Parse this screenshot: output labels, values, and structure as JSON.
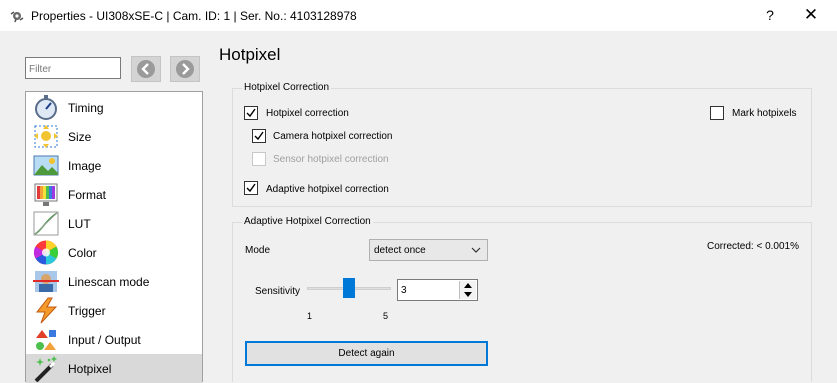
{
  "window": {
    "title": "Properties - UI308xSE-C | Cam. ID: 1 | Ser. No.: 4103128978",
    "help_label": "?",
    "close_label": "✕"
  },
  "sidebar": {
    "filter_placeholder": "Filter",
    "items": [
      {
        "label": "Timing",
        "icon": "stopwatch-icon"
      },
      {
        "label": "Size",
        "icon": "size-icon"
      },
      {
        "label": "Image",
        "icon": "image-icon"
      },
      {
        "label": "Format",
        "icon": "format-icon"
      },
      {
        "label": "LUT",
        "icon": "lut-icon"
      },
      {
        "label": "Color",
        "icon": "color-wheel-icon"
      },
      {
        "label": "Linescan mode",
        "icon": "linescan-icon"
      },
      {
        "label": "Trigger",
        "icon": "trigger-icon"
      },
      {
        "label": "Input / Output",
        "icon": "input-output-icon"
      },
      {
        "label": "Hotpixel",
        "icon": "hotpixel-wand-icon",
        "selected": true
      }
    ]
  },
  "main": {
    "title": "Hotpixel",
    "correction_group": {
      "title": "Hotpixel Correction",
      "hotpixel_correction": {
        "label": "Hotpixel correction",
        "checked": true
      },
      "camera_correction": {
        "label": "Camera hotpixel correction",
        "checked": true
      },
      "sensor_correction": {
        "label": "Sensor hotpixel correction",
        "checked": false,
        "disabled": true
      },
      "adaptive_correction": {
        "label": "Adaptive hotpixel correction",
        "checked": true
      },
      "mark_hotpixels": {
        "label": "Mark hotpixels",
        "checked": false
      }
    },
    "adaptive_group": {
      "title": "Adaptive Hotpixel Correction",
      "mode_label": "Mode",
      "mode_value": "detect once",
      "corrected_text": "Corrected: < 0.001%",
      "sensitivity_label": "Sensitivity",
      "sensitivity_min": "1",
      "sensitivity_max": "5",
      "sensitivity_value": "3",
      "detect_button": "Detect again"
    }
  },
  "colors": {
    "accent": "#0078d7",
    "background": "#f0f0f0",
    "selected_item": "#d9d9d9"
  }
}
